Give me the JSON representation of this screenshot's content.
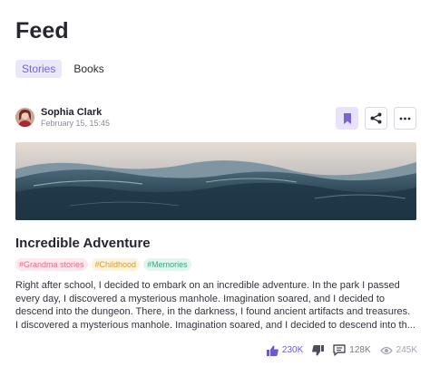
{
  "header": {
    "title": "Feed"
  },
  "tabs": [
    {
      "label": "Stories",
      "active": true
    },
    {
      "label": "Books",
      "active": false
    }
  ],
  "post": {
    "author": {
      "name": "Sophia Clark",
      "date": "February 15, 15:45"
    },
    "actions": {
      "bookmark_icon": "bookmark-icon",
      "share_icon": "share-icon",
      "more_icon": "more-horizontal-icon"
    },
    "title": "Incredible Adventure",
    "tags": [
      "#Grandma stories",
      "#Childhood",
      "#Memories"
    ],
    "body_lines": [
      "Right after school, I decided to embark on an incredible adventure. In the park I passed",
      "every day, I discovered a mysterious manhole. Imagination soared, and I decided to",
      "descend into the dungeon. There, in the darkness, I found ancient artifacts and treasures.",
      "I discovered a mysterious manhole. Imagination soared, and I decided to descend into th..."
    ],
    "stats": {
      "likes": "230K",
      "comments": "128K",
      "views": "245K"
    }
  },
  "colors": {
    "accent": "#7b63d6",
    "accent_bg": "#ebe7fb"
  }
}
